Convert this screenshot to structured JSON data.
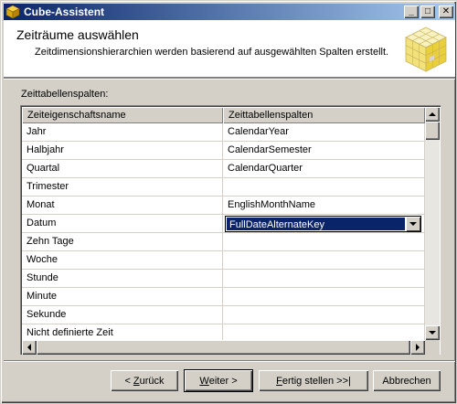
{
  "window": {
    "title": "Cube-Assistent",
    "controls": {
      "minimize": "_",
      "maximize": "□",
      "close": "✕"
    }
  },
  "header": {
    "title": "Zeiträume auswählen",
    "subtitle": "Zeitdimensionshierarchien werden basierend auf ausgewählten Spalten erstellt."
  },
  "grid": {
    "label": "Zeittabellenspalten:",
    "columns": [
      "Zeiteigenschaftsname",
      "Zeittabellenspalten"
    ],
    "rows": [
      {
        "name": "Jahr",
        "column": "CalendarYear"
      },
      {
        "name": "Halbjahr",
        "column": "CalendarSemester"
      },
      {
        "name": "Quartal",
        "column": "CalendarQuarter"
      },
      {
        "name": "Trimester",
        "column": ""
      },
      {
        "name": "Monat",
        "column": "EnglishMonthName"
      },
      {
        "name": "Datum",
        "column": "FullDateAlternateKey"
      },
      {
        "name": "Zehn Tage",
        "column": ""
      },
      {
        "name": "Woche",
        "column": ""
      },
      {
        "name": "Stunde",
        "column": ""
      },
      {
        "name": "Minute",
        "column": ""
      },
      {
        "name": "Sekunde",
        "column": ""
      },
      {
        "name": "Nicht definierte Zeit",
        "column": ""
      }
    ],
    "selected_row": 5
  },
  "buttons": {
    "back": {
      "prefix": "< ",
      "accel": "Z",
      "rest": "urück"
    },
    "next": {
      "accel": "W",
      "rest": "eiter >"
    },
    "finish": {
      "accel": "F",
      "rest": "ertig stellen >>|"
    },
    "cancel": "Abbrechen"
  },
  "icons": {
    "app": "cube-icon",
    "header": "cube-grid-icon"
  }
}
